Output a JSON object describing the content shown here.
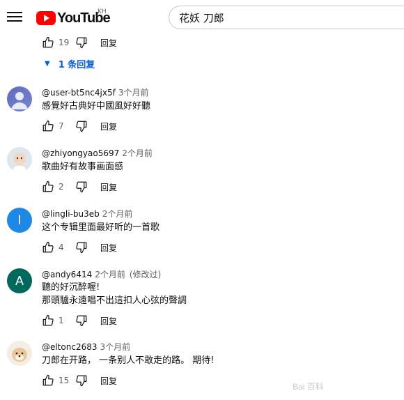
{
  "header": {
    "logo_text": "YouTube",
    "region_code": "KH",
    "search_query": "花妖 刀郎"
  },
  "top_comment": {
    "likes": "19",
    "reply_label": "回复",
    "replies_toggle": "1 条回复"
  },
  "comments": [
    {
      "author": "@user-bt5nc4jx5f",
      "time": "3个月前",
      "lines": [
        "感覺好古典好中國風好好聽"
      ],
      "likes": "7",
      "reply_label": "回复",
      "avatar": "gradient"
    },
    {
      "author": "@zhiyongyao5697",
      "time": "2个月前",
      "lines": [
        "歌曲好有故事画面感"
      ],
      "likes": "2",
      "reply_label": "回复",
      "avatar": "baby-photo"
    },
    {
      "author": "@lingli-bu3eb",
      "time": "2个月前",
      "lines": [
        "这个专辑里面最好听的一首歌"
      ],
      "likes": "4",
      "reply_label": "回复",
      "avatar": "letter",
      "avatar_letter": "l",
      "avatar_color": "#1e88e5"
    },
    {
      "author": "@andy6414",
      "time": "2个月前",
      "edited": "(修改过)",
      "lines": [
        "聽的好沉醉喔!",
        "那頭驢永遠唱不出這扣人心弦的聲調"
      ],
      "likes": "1",
      "reply_label": "回复",
      "avatar": "letter",
      "avatar_letter": "A",
      "avatar_color": "#00695c"
    },
    {
      "author": "@eltonc2683",
      "time": "3个月前",
      "lines": [
        "刀郎在开路， 一条别人不敢走的路。 期待!"
      ],
      "likes": "15",
      "reply_label": "回复",
      "avatar": "dog-photo"
    }
  ],
  "watermark": "Bai 百科"
}
